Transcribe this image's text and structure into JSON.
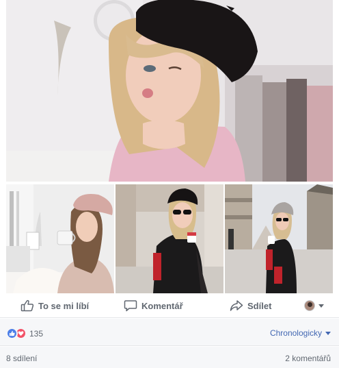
{
  "actions": {
    "like_label": "To se mi líbí",
    "comment_label": "Komentář",
    "share_label": "Sdílet"
  },
  "reactions": {
    "count": "135",
    "types": [
      "like",
      "love"
    ]
  },
  "sort": {
    "label": "Chronologicky"
  },
  "footer": {
    "shares": "8 sdílení",
    "comments": "2 komentářů"
  },
  "colors": {
    "like_blue": "#4c7fe8",
    "love_red": "#f25268",
    "link_blue": "#4267b2",
    "muted_text": "#606770",
    "footer_bg": "#f6f7f9"
  }
}
